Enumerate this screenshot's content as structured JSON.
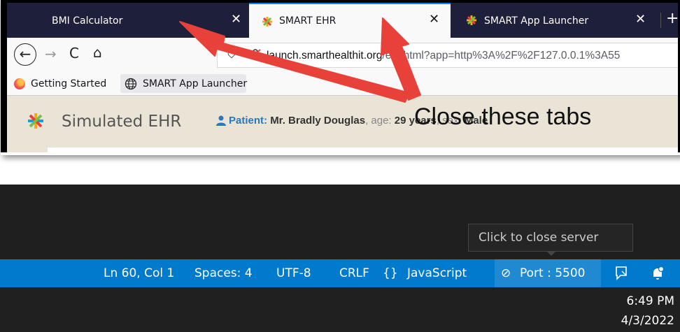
{
  "browser": {
    "tabs": [
      {
        "label": "BMI Calculator",
        "close": "✕"
      },
      {
        "label": "SMART EHR",
        "close": "✕"
      },
      {
        "label": "SMART App Launcher",
        "close": "✕"
      }
    ],
    "new_tab": "+",
    "nav": {
      "back": "←",
      "forward": "→",
      "reload": "C",
      "home": "⌂"
    },
    "url": {
      "host_visible": "launch.smarthealthit.org",
      "path": "/ehr.html?app=http%3A%2F%2F127.0.0.1%3A55"
    },
    "bookmarks": [
      {
        "label": "Getting Started",
        "icon": "firefox-icon"
      },
      {
        "label": "SMART App Launcher",
        "icon": "globe-icon"
      }
    ],
    "ehr": {
      "title": "Simulated EHR",
      "patient_label": "Patient:",
      "patient_name": "Mr. Bradly Douglas",
      "age_label": ", age: ",
      "age_value": "29 years",
      "sex_label": ", sex: ",
      "sex_value": "Male"
    }
  },
  "annotation": {
    "text": "Close these tabs",
    "arrow_color": "#e8413a"
  },
  "vscode": {
    "tooltip": "Click to close server",
    "status": {
      "position": "Ln 60, Col 1",
      "spaces": "Spaces: 4",
      "encoding": "UTF-8",
      "eol": "CRLF",
      "language_icon": "{}",
      "language": "JavaScript",
      "port": "Port : 5500",
      "port_icon": "⊘"
    },
    "clock": {
      "time": "6:49 PM",
      "date": "4/3/2022"
    },
    "statusbar_color": "#007acc"
  }
}
